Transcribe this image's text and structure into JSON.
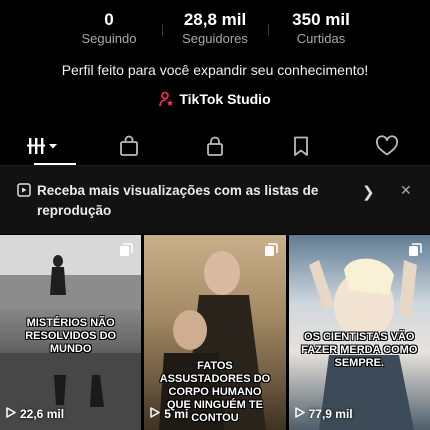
{
  "stats": [
    {
      "value": "0",
      "label": "Seguindo"
    },
    {
      "value": "28,8 mil",
      "label": "Seguidores"
    },
    {
      "value": "350 mil",
      "label": "Curtidas"
    }
  ],
  "bio": "Perfil feito para você expandir seu conhecimento!",
  "studio": {
    "label": "TikTok Studio",
    "icon": "person-star-icon",
    "icon_color": "#fe2c55"
  },
  "tabs": [
    {
      "name": "videos",
      "icon": "grid-icon",
      "active": true
    },
    {
      "name": "shop",
      "icon": "shopping-bag-icon"
    },
    {
      "name": "private",
      "icon": "lock-icon"
    },
    {
      "name": "saved",
      "icon": "bookmark-icon"
    },
    {
      "name": "liked",
      "icon": "heart-icon"
    }
  ],
  "banner": {
    "text": "Receba mais visualizações com as listas de reprodução"
  },
  "videos": [
    {
      "caption": "MISTÉRIOS NÃO RESOLVIDOS DO MUNDO",
      "views": "22,6 mil"
    },
    {
      "caption": "FATOS ASSUSTADORES DO CORPO HUMANO QUE NINGUÉM TE CONTOU",
      "views": "5 mi"
    },
    {
      "caption": "OS CIENTISTAS VÃO FAZER MERDA COMO SEMPRE.",
      "views": "77,9 mil"
    }
  ],
  "colors": {
    "background": "#000000",
    "banner": "#121212",
    "accent": "#fe2c55"
  }
}
